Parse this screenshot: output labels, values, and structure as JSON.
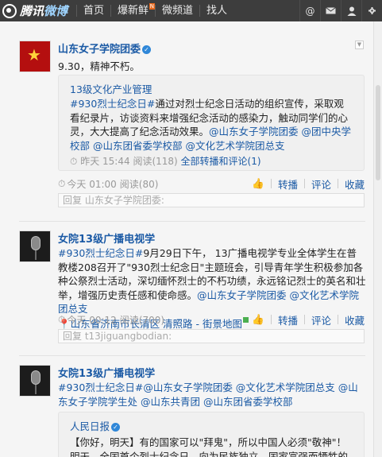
{
  "topbar": {
    "logo_text_1": "腾讯",
    "logo_text_2": "微博",
    "nav": [
      "首页",
      "爆新鲜",
      "微频道",
      "找人"
    ],
    "new_badge": "N",
    "icons": [
      "@",
      "mail-icon",
      "user-icon",
      "settings-icon"
    ]
  },
  "posts": [
    {
      "author": "山东女子学院团委",
      "text": "9.30，精神不朽。",
      "repost": {
        "author": "13级文化产业管理",
        "text_a": "#930烈士纪念日#",
        "text_b": "通过对烈士纪念日活动的组织宣传，采取观看纪录片，访谈资料来增强纪念活动的感染力，触动同学们的心灵，大大提高了纪念活动效果。",
        "mentions": "@山东女子学院团委 @团中央学校部 @山东团省委学校部 @文化艺术学院团总支",
        "time": "昨天 15:44",
        "read": "阅读(118)",
        "all_link": "全部转播和评论(1)"
      },
      "time": "今天 01:00",
      "read": "阅读(80)",
      "actions": [
        "转播",
        "评论",
        "收藏"
      ],
      "reply_placeholder": "回复 山东女子学院团委:"
    },
    {
      "author": "女院13级广播电视学",
      "text_a": "#930烈士纪念日#",
      "text_b": "9月29日下午， 13广播电视学专业全体学生在普教楼208召开了\"930烈士纪念日\"主题班会，引导青年学生积极参加各种公祭烈士活动，深切缅怀烈士的不朽功绩，永远铭记烈士的英名和壮举，增强历史责任感和使命感。",
      "mentions": "@山东女子学院团委 @文化艺术学院团总支",
      "location": "山东省济南市长清区 清照路 - 街景地图",
      "time": "今天 00:12",
      "read": "阅读(700)",
      "actions": [
        "转播",
        "评论",
        "收藏"
      ],
      "reply_placeholder": "回复 t13jiguangbodian:"
    },
    {
      "author": "女院13级广播电视学",
      "text_a": "#930烈士纪念日#",
      "mentions": "@山东女子学院团委 @文化艺术学院团总支 @山东女子学院学生处 @山东共青团 @山东团省委学校部",
      "repost": {
        "author": "人民日报",
        "text": "【你好，明天】有的国家可以\"拜鬼\"，所以中国人必须\"敬神\"！明天，全国首个烈士纪念日，向为民族独立、国家富强而牺牲的先烈"
      }
    }
  ]
}
